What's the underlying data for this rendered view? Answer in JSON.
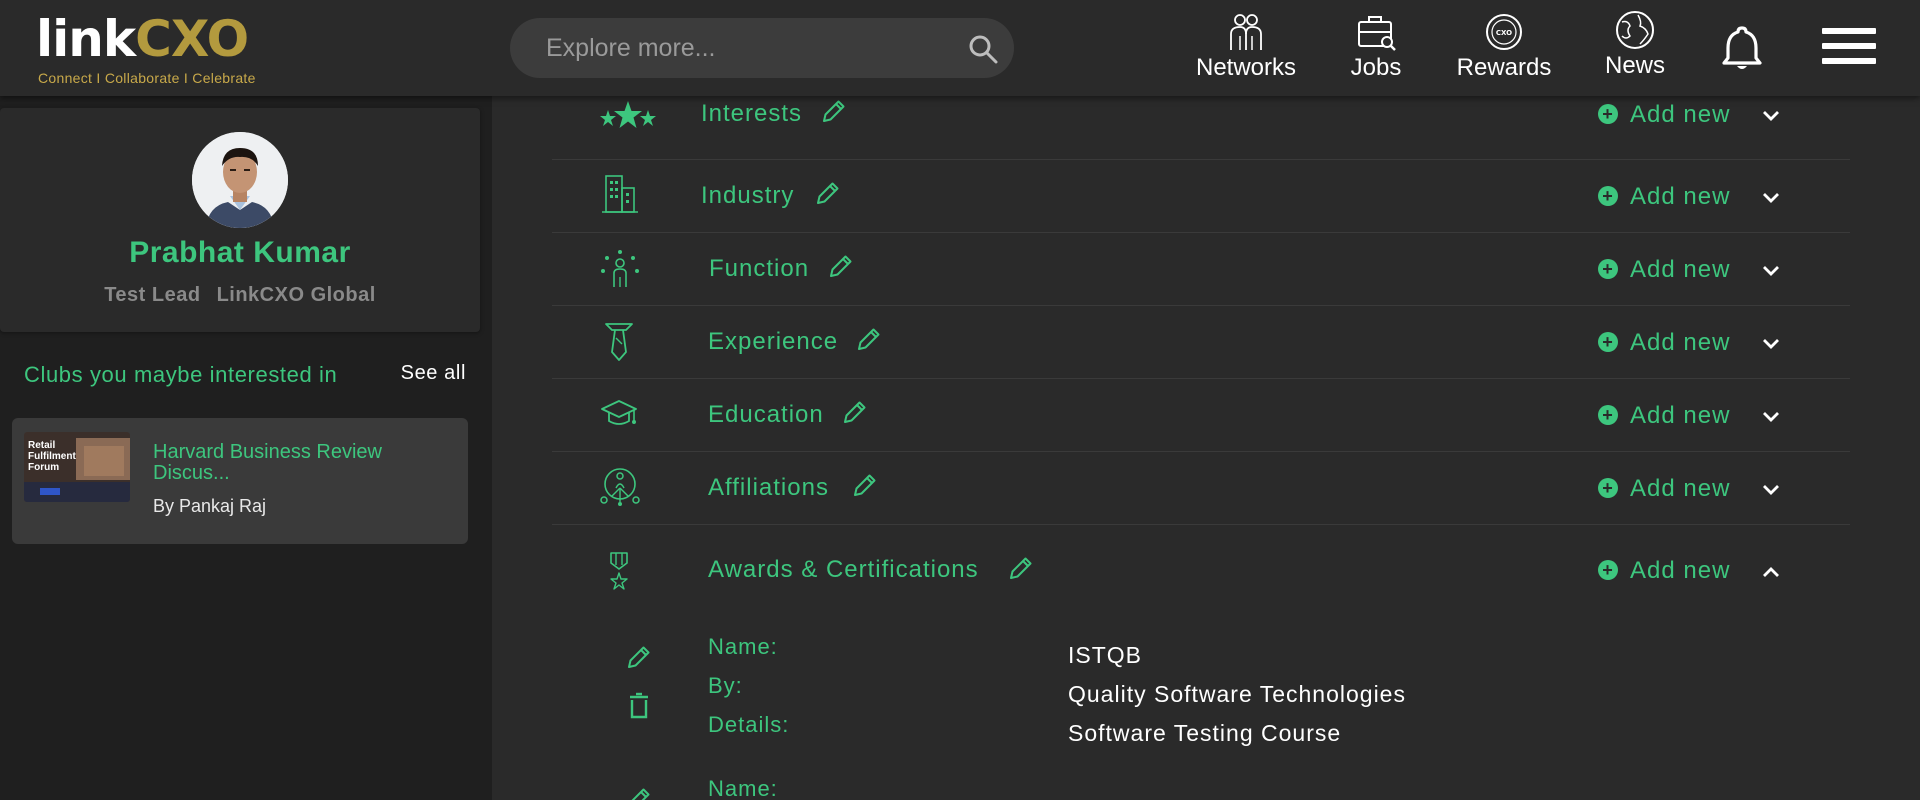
{
  "header": {
    "logo_word_white": "link",
    "logo_word_gold": "CXO",
    "logo_tagline": "Connect I Collaborate I Celebrate",
    "search_placeholder": "Explore more...",
    "nav": [
      {
        "label": "Networks",
        "icon": "networks-icon"
      },
      {
        "label": "Jobs",
        "icon": "jobs-icon"
      },
      {
        "label": "Rewards",
        "icon": "rewards-icon"
      },
      {
        "label": "News",
        "icon": "globe-icon"
      }
    ],
    "bell_icon": "bell-icon",
    "menu_icon": "hamburger-menu-icon"
  },
  "profile": {
    "name": "Prabhat Kumar",
    "role": "Test Lead",
    "company": "LinkCXO Global"
  },
  "clubs": {
    "title": "Clubs you maybe interested in",
    "see_all": "See all",
    "items": [
      {
        "title": "Harvard Business Review Discus...",
        "by": "By Pankaj Raj",
        "thumb_text": "Retail Fulfilment Forum"
      }
    ]
  },
  "sections": [
    {
      "label": "Interests",
      "add": "Add new",
      "icon": "stars-icon",
      "expanded": false
    },
    {
      "label": "Industry",
      "add": "Add new",
      "icon": "building-icon",
      "expanded": false
    },
    {
      "label": "Function",
      "add": "Add new",
      "icon": "function-person-icon",
      "expanded": false
    },
    {
      "label": "Experience",
      "add": "Add new",
      "icon": "tie-icon",
      "expanded": false
    },
    {
      "label": "Education",
      "add": "Add new",
      "icon": "graduation-cap-icon",
      "expanded": false
    },
    {
      "label": "Affiliations",
      "add": "Add new",
      "icon": "affiliation-network-icon",
      "expanded": false
    },
    {
      "label": "Awards & Certifications",
      "add": "Add new",
      "icon": "medal-icon",
      "expanded": true
    }
  ],
  "award_entries": [
    {
      "labels": [
        "Name:",
        "By:",
        "Details:"
      ],
      "values": [
        "ISTQB",
        "Quality Software Technologies",
        "Software Testing Course"
      ]
    },
    {
      "labels": [
        "Name:"
      ],
      "values": [
        ""
      ]
    }
  ],
  "colors": {
    "accent": "#3dc67e",
    "gold": "#b39a3e",
    "header_bg": "#2a2a2a",
    "page_bg": "#1f1f1f"
  }
}
